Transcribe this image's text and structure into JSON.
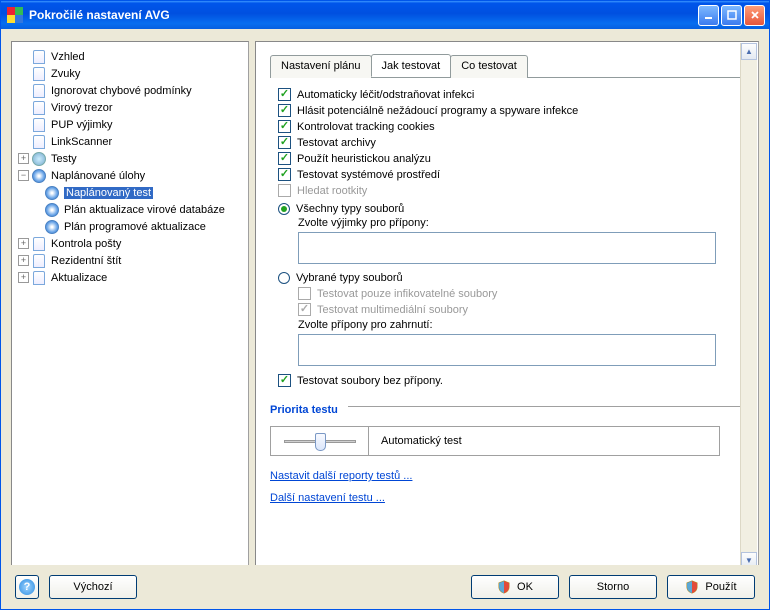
{
  "window": {
    "title": "Pokročilé nastavení AVG"
  },
  "tree": [
    {
      "label": "Vzhled",
      "type": "page",
      "indent": 0,
      "toggle": ""
    },
    {
      "label": "Zvuky",
      "type": "page",
      "indent": 0,
      "toggle": ""
    },
    {
      "label": "Ignorovat chybové podmínky",
      "type": "page",
      "indent": 0,
      "toggle": ""
    },
    {
      "label": "Virový trezor",
      "type": "page",
      "indent": 0,
      "toggle": ""
    },
    {
      "label": "PUP výjimky",
      "type": "page",
      "indent": 0,
      "toggle": ""
    },
    {
      "label": "LinkScanner",
      "type": "page",
      "indent": 0,
      "toggle": ""
    },
    {
      "label": "Testy",
      "type": "search",
      "indent": 0,
      "toggle": "+"
    },
    {
      "label": "Naplánované úlohy",
      "type": "clock",
      "indent": 0,
      "toggle": "−"
    },
    {
      "label": "Naplánovaný test",
      "type": "clock",
      "indent": 1,
      "toggle": "",
      "selected": true
    },
    {
      "label": "Plán aktualizace virové databáze",
      "type": "clock",
      "indent": 1,
      "toggle": ""
    },
    {
      "label": "Plán programové aktualizace",
      "type": "clock",
      "indent": 1,
      "toggle": ""
    },
    {
      "label": "Kontrola pošty",
      "type": "page",
      "indent": 0,
      "toggle": "+"
    },
    {
      "label": "Rezidentní štít",
      "type": "page",
      "indent": 0,
      "toggle": "+"
    },
    {
      "label": "Aktualizace",
      "type": "page",
      "indent": 0,
      "toggle": "+"
    }
  ],
  "tabs": [
    {
      "label": "Nastavení plánu",
      "key": "tab-schedule"
    },
    {
      "label": "Jak testovat",
      "key": "tab-how"
    },
    {
      "label": "Co testovat",
      "key": "tab-what"
    }
  ],
  "activeTab": 1,
  "checks": {
    "auto_heal": "Automaticky léčit/odstraňovat infekci",
    "report_pup": "Hlásit potenciálně nežádoucí programy a spyware infekce",
    "tracking": "Kontrolovat tracking cookies",
    "archives": "Testovat archivy",
    "heuristic": "Použít heuristickou analýzu",
    "system_env": "Testovat systémové prostředí",
    "rootkits": "Hledat rootkity",
    "test_infect_only": "Testovat pouze infikovatelné soubory",
    "test_multimedia": "Testovat multimediální soubory",
    "no_ext": "Testovat soubory bez přípony."
  },
  "radios": {
    "all_types": "Všechny typy souborů",
    "selected_types": "Vybrané typy souborů"
  },
  "labels": {
    "exclude_ext": "Zvolte výjimky pro přípony:",
    "include_ext": "Zvolte přípony pro zahrnutí:",
    "priority_group": "Priorita testu",
    "slider_label": "Automatický test",
    "link_reports": "Nastavit další reporty testů ...",
    "link_more": "Další nastavení testu ..."
  },
  "buttons": {
    "default": "Výchozí",
    "ok": "OK",
    "cancel": "Storno",
    "apply": "Použít"
  }
}
